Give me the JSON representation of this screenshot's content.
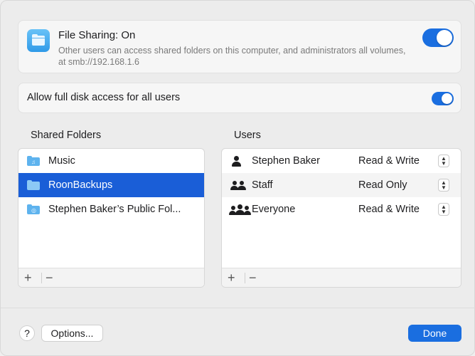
{
  "file_sharing": {
    "title": "File Sharing: On",
    "description": "Other users can access shared folders on this computer, and administrators all volumes, at smb://192.168.1.6",
    "enabled": true
  },
  "disk_access": {
    "label": "Allow full disk access for all users",
    "enabled": true
  },
  "shared_folders": {
    "label": "Shared Folders",
    "items": [
      {
        "name": "Music",
        "selected": false
      },
      {
        "name": "RoonBackups",
        "selected": true
      },
      {
        "name": "Stephen Baker’s Public Fol...",
        "selected": false
      }
    ],
    "add": "+",
    "remove": "−"
  },
  "users": {
    "label": "Users",
    "items": [
      {
        "name": "Stephen Baker",
        "permission": "Read & Write",
        "icon": "person-icon"
      },
      {
        "name": "Staff",
        "permission": "Read Only",
        "icon": "group-icon"
      },
      {
        "name": "Everyone",
        "permission": "Read & Write",
        "icon": "everyone-icon"
      }
    ],
    "add": "+",
    "remove": "−"
  },
  "footer": {
    "help": "?",
    "options": "Options...",
    "done": "Done"
  },
  "colors": {
    "accent": "#1a6ee0",
    "selection": "#1a5ed7"
  }
}
